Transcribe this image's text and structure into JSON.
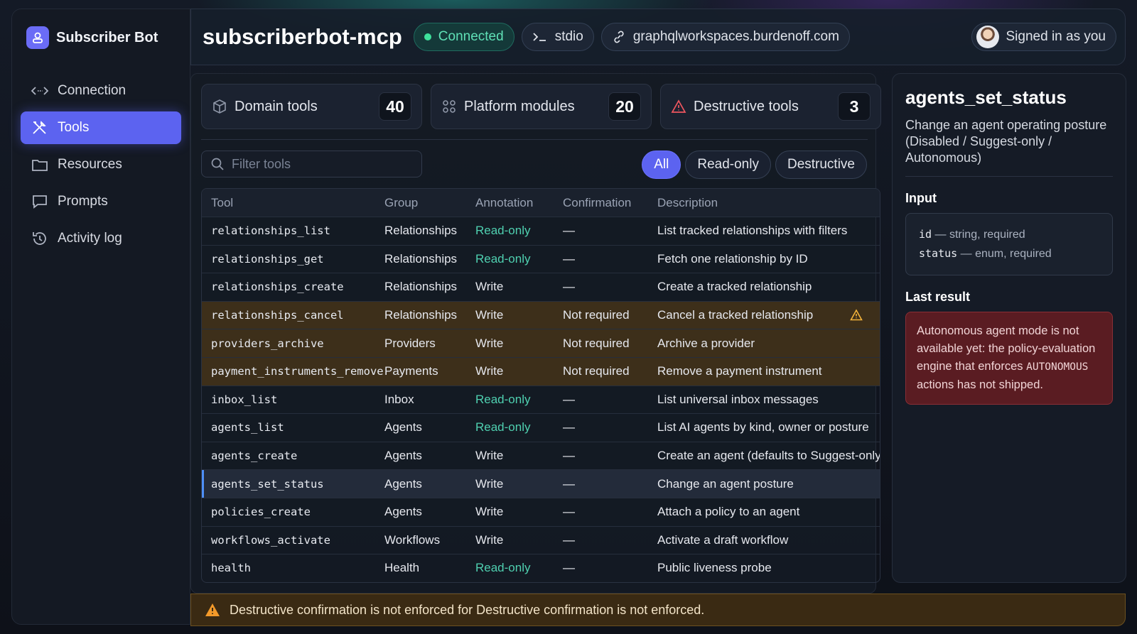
{
  "brand": {
    "name": "Subscriber Bot",
    "icon": "bot-icon"
  },
  "nav": [
    {
      "label": "Connection",
      "icon": "connection-icon",
      "active": false
    },
    {
      "label": "Tools",
      "icon": "tools-icon",
      "active": true
    },
    {
      "label": "Resources",
      "icon": "folder-icon",
      "active": false
    },
    {
      "label": "Prompts",
      "icon": "chat-icon",
      "active": false
    },
    {
      "label": "Activity log",
      "icon": "history-icon",
      "active": false
    }
  ],
  "header": {
    "title": "subscriberbot-mcp",
    "status": "Connected",
    "transport": "stdio",
    "host": "graphqlworkspaces.burdenoff.com",
    "user": "Signed in as you"
  },
  "stats": [
    {
      "label": "Domain tools",
      "count": "40",
      "icon": "cube-icon"
    },
    {
      "label": "Platform modules",
      "count": "20",
      "icon": "modules-icon"
    },
    {
      "label": "Destructive tools",
      "count": "3",
      "icon": "warning-icon"
    }
  ],
  "filter": {
    "placeholder": "Filter tools"
  },
  "segments": [
    {
      "label": "All",
      "active": true
    },
    {
      "label": "Read-only",
      "active": false
    },
    {
      "label": "Destructive",
      "active": false
    }
  ],
  "table": {
    "headers": [
      "Tool",
      "Group",
      "Annotation",
      "Confirmation",
      "Description"
    ],
    "rows": [
      {
        "tool": "relationships_list",
        "group": "Relationships",
        "annotation": "Read-only",
        "confirmation": "—",
        "description": "List tracked relationships with filters",
        "state": ""
      },
      {
        "tool": "relationships_get",
        "group": "Relationships",
        "annotation": "Read-only",
        "confirmation": "—",
        "description": "Fetch one relationship by ID",
        "state": ""
      },
      {
        "tool": "relationships_create",
        "group": "Relationships",
        "annotation": "Write",
        "confirmation": "—",
        "description": "Create a tracked relationship",
        "state": ""
      },
      {
        "tool": "relationships_cancel",
        "group": "Relationships",
        "annotation": "Write",
        "confirmation": "Not required",
        "description": "Cancel a tracked relationship",
        "state": "warn",
        "flag": true
      },
      {
        "tool": "providers_archive",
        "group": "Providers",
        "annotation": "Write",
        "confirmation": "Not required",
        "description": "Archive a provider",
        "state": "warn"
      },
      {
        "tool": "payment_instruments_remove",
        "group": "Payments",
        "annotation": "Write",
        "confirmation": "Not required",
        "description": "Remove a payment instrument",
        "state": "warn"
      },
      {
        "tool": "inbox_list",
        "group": "Inbox",
        "annotation": "Read-only",
        "confirmation": "—",
        "description": "List universal inbox messages",
        "state": ""
      },
      {
        "tool": "agents_list",
        "group": "Agents",
        "annotation": "Read-only",
        "confirmation": "—",
        "description": "List AI agents by kind, owner or posture",
        "state": ""
      },
      {
        "tool": "agents_create",
        "group": "Agents",
        "annotation": "Write",
        "confirmation": "—",
        "description": "Create an agent (defaults to Suggest-only)",
        "state": ""
      },
      {
        "tool": "agents_set_status",
        "group": "Agents",
        "annotation": "Write",
        "confirmation": "—",
        "description": "Change an agent posture",
        "state": "selected"
      },
      {
        "tool": "policies_create",
        "group": "Agents",
        "annotation": "Write",
        "confirmation": "—",
        "description": "Attach a policy to an agent",
        "state": ""
      },
      {
        "tool": "workflows_activate",
        "group": "Workflows",
        "annotation": "Write",
        "confirmation": "—",
        "description": "Activate a draft workflow",
        "state": ""
      },
      {
        "tool": "health",
        "group": "Health",
        "annotation": "Read-only",
        "confirmation": "—",
        "description": "Public liveness probe",
        "state": ""
      }
    ]
  },
  "panel": {
    "title": "agents_set_status",
    "description": "Change an agent operating posture (Disabled / Suggest-only / Autonomous)",
    "input_heading": "Input",
    "inputs": [
      {
        "name": "id",
        "type": "— string, required"
      },
      {
        "name": "status",
        "type": "— enum, required"
      }
    ],
    "result_heading": "Last result",
    "result_pre": "Autonomous agent mode is not available yet: the policy-evaluation engine that enforces ",
    "result_code": "AUTONOMOUS",
    "result_post": " actions has not shipped."
  },
  "banner": {
    "text": "Destructive confirmation is not enforced for Destructive confirmation is not enforced."
  },
  "colors": {
    "accent": "#5c63f0",
    "readonly": "#4fd0b0",
    "warn_row": "#3d2f1a",
    "error": "#5a1c22"
  }
}
